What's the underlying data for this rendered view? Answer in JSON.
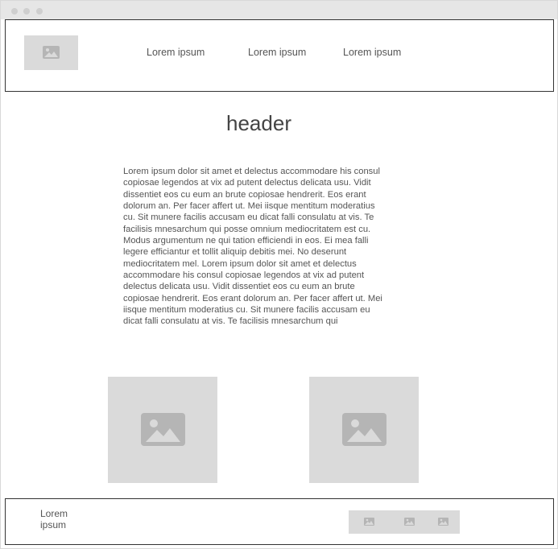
{
  "window": {
    "controls": [
      "close",
      "minimize",
      "maximize"
    ]
  },
  "header_nav": {
    "logo_icon": "image-placeholder-icon",
    "links": [
      "Lorem ipsum",
      "Lorem ipsum",
      "Lorem ipsum"
    ]
  },
  "main": {
    "title": "header",
    "paragraph": "Lorem ipsum dolor sit amet et delectus accommodare his consul copiosae legendos at vix ad putent delectus delicata usu. Vidit dissentiet eos cu eum an brute copiosae hendrerit. Eos erant dolorum an. Per facer affert ut. Mei iisque mentitum moderatius cu. Sit munere facilis accusam eu dicat falli consulatu at vis. Te facilisis mnesarchum qui posse omnium mediocritatem est cu. Modus argumentum ne qui tation efficiendi in eos. Ei mea falli legere efficiantur et tollit aliquip debitis mei. No deserunt mediocritatem mel. Lorem ipsum dolor sit amet et delectus accommodare his consul copiosae legendos at vix ad putent delectus delicata usu. Vidit dissentiet eos cu eum an brute copiosae hendrerit. Eos erant dolorum an. Per facer affert ut. Mei iisque mentitum moderatius cu. Sit munere facilis accusam eu dicat falli consulatu at vis. Te facilisis mnesarchum qui",
    "images": [
      "image-placeholder-icon",
      "image-placeholder-icon"
    ]
  },
  "footer": {
    "text": "Lorem ipsum",
    "social_icons": [
      "image-placeholder-icon",
      "image-placeholder-icon",
      "image-placeholder-icon"
    ]
  },
  "colors": {
    "placeholder_bg": "#dadada",
    "placeholder_icon": "#b5b5b5",
    "border": "#333333",
    "text": "#555555",
    "titlebar": "#e6e6e6"
  }
}
